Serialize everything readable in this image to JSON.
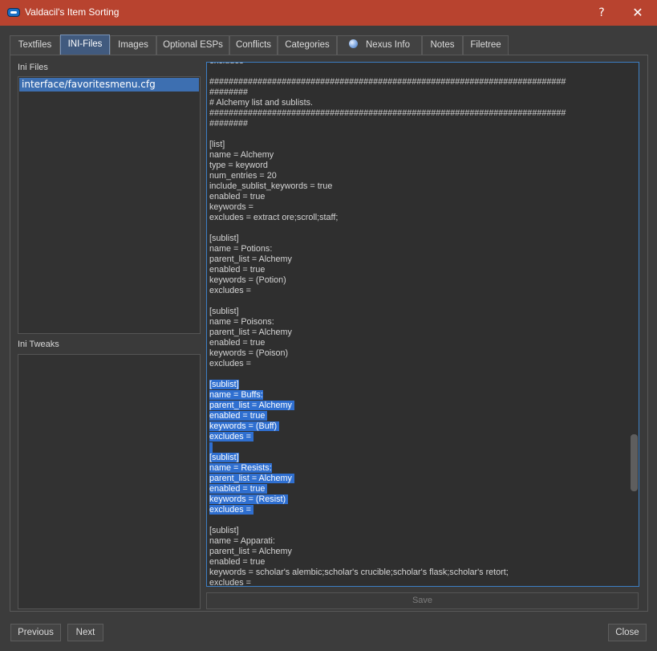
{
  "window": {
    "title": "Valdacil's Item Sorting",
    "icon": "app-icon",
    "help_label": "?",
    "close_label": "✕",
    "titlebar_color": "#b8432f"
  },
  "tabs": [
    {
      "label": "Textfiles",
      "active": false
    },
    {
      "label": "INI-Files",
      "active": true
    },
    {
      "label": "Images",
      "active": false
    },
    {
      "label": "Optional ESPs",
      "active": false
    },
    {
      "label": "Conflicts",
      "active": false
    },
    {
      "label": "Categories",
      "active": false
    },
    {
      "label": "Nexus Info",
      "active": false,
      "icon": "globe-icon"
    },
    {
      "label": "Notes",
      "active": false
    },
    {
      "label": "Filetree",
      "active": false
    }
  ],
  "left_panel": {
    "ini_files_label": "Ini Files",
    "ini_files": [
      "interface/favoritesmenu.cfg"
    ],
    "ini_tweaks_label": "Ini Tweaks"
  },
  "editor": {
    "lines": [
      {
        "text": "excludes =",
        "sel": false
      },
      {
        "text": "",
        "sel": false
      },
      {
        "text": "##########################################################################",
        "sel": false
      },
      {
        "text": "########",
        "sel": false
      },
      {
        "text": "# Alchemy list and sublists.",
        "sel": false
      },
      {
        "text": "##########################################################################",
        "sel": false
      },
      {
        "text": "########",
        "sel": false
      },
      {
        "text": "",
        "sel": false
      },
      {
        "text": "[list]",
        "sel": false
      },
      {
        "text": "name = Alchemy",
        "sel": false
      },
      {
        "text": "type = keyword",
        "sel": false
      },
      {
        "text": "num_entries = 20",
        "sel": false
      },
      {
        "text": "include_sublist_keywords = true",
        "sel": false
      },
      {
        "text": "enabled = true",
        "sel": false
      },
      {
        "text": "keywords =",
        "sel": false
      },
      {
        "text": "excludes = extract ore;scroll;staff;",
        "sel": false
      },
      {
        "text": "",
        "sel": false
      },
      {
        "text": "[sublist]",
        "sel": false
      },
      {
        "text": "name = Potions:",
        "sel": false
      },
      {
        "text": "parent_list = Alchemy",
        "sel": false
      },
      {
        "text": "enabled = true",
        "sel": false
      },
      {
        "text": "keywords = (Potion)",
        "sel": false
      },
      {
        "text": "excludes =",
        "sel": false
      },
      {
        "text": "",
        "sel": false
      },
      {
        "text": "[sublist]",
        "sel": false
      },
      {
        "text": "name = Poisons:",
        "sel": false
      },
      {
        "text": "parent_list = Alchemy",
        "sel": false
      },
      {
        "text": "enabled = true",
        "sel": false
      },
      {
        "text": "keywords = (Poison)",
        "sel": false
      },
      {
        "text": "excludes =",
        "sel": false
      },
      {
        "text": "",
        "sel": false
      },
      {
        "text": "[sublist]",
        "sel": true
      },
      {
        "text": "name = Buffs:",
        "sel": true
      },
      {
        "text": "parent_list = Alchemy ",
        "sel": true
      },
      {
        "text": "enabled = true ",
        "sel": true
      },
      {
        "text": "keywords = (Buff) ",
        "sel": true
      },
      {
        "text": "excludes = ",
        "sel": true
      },
      {
        "text": "",
        "sel": true
      },
      {
        "text": "[sublist]",
        "sel": true
      },
      {
        "text": "name = Resists:",
        "sel": true
      },
      {
        "text": "parent_list = Alchemy ",
        "sel": true
      },
      {
        "text": "enabled = true ",
        "sel": true
      },
      {
        "text": "keywords = (Resist) ",
        "sel": true
      },
      {
        "text": "excludes = ",
        "sel": true
      },
      {
        "text": "",
        "sel": false
      },
      {
        "text": "[sublist]",
        "sel": false
      },
      {
        "text": "name = Apparati:",
        "sel": false
      },
      {
        "text": "parent_list = Alchemy",
        "sel": false
      },
      {
        "text": "enabled = true",
        "sel": false
      },
      {
        "text": "keywords = scholar's alembic;scholar's crucible;scholar's flask;scholar's retort;",
        "sel": false
      },
      {
        "text": "excludes =",
        "sel": false
      }
    ],
    "selection_color": "#2f6fd0"
  },
  "save_label": "Save",
  "footer": {
    "previous_label": "Previous",
    "next_label": "Next",
    "close_label": "Close"
  }
}
